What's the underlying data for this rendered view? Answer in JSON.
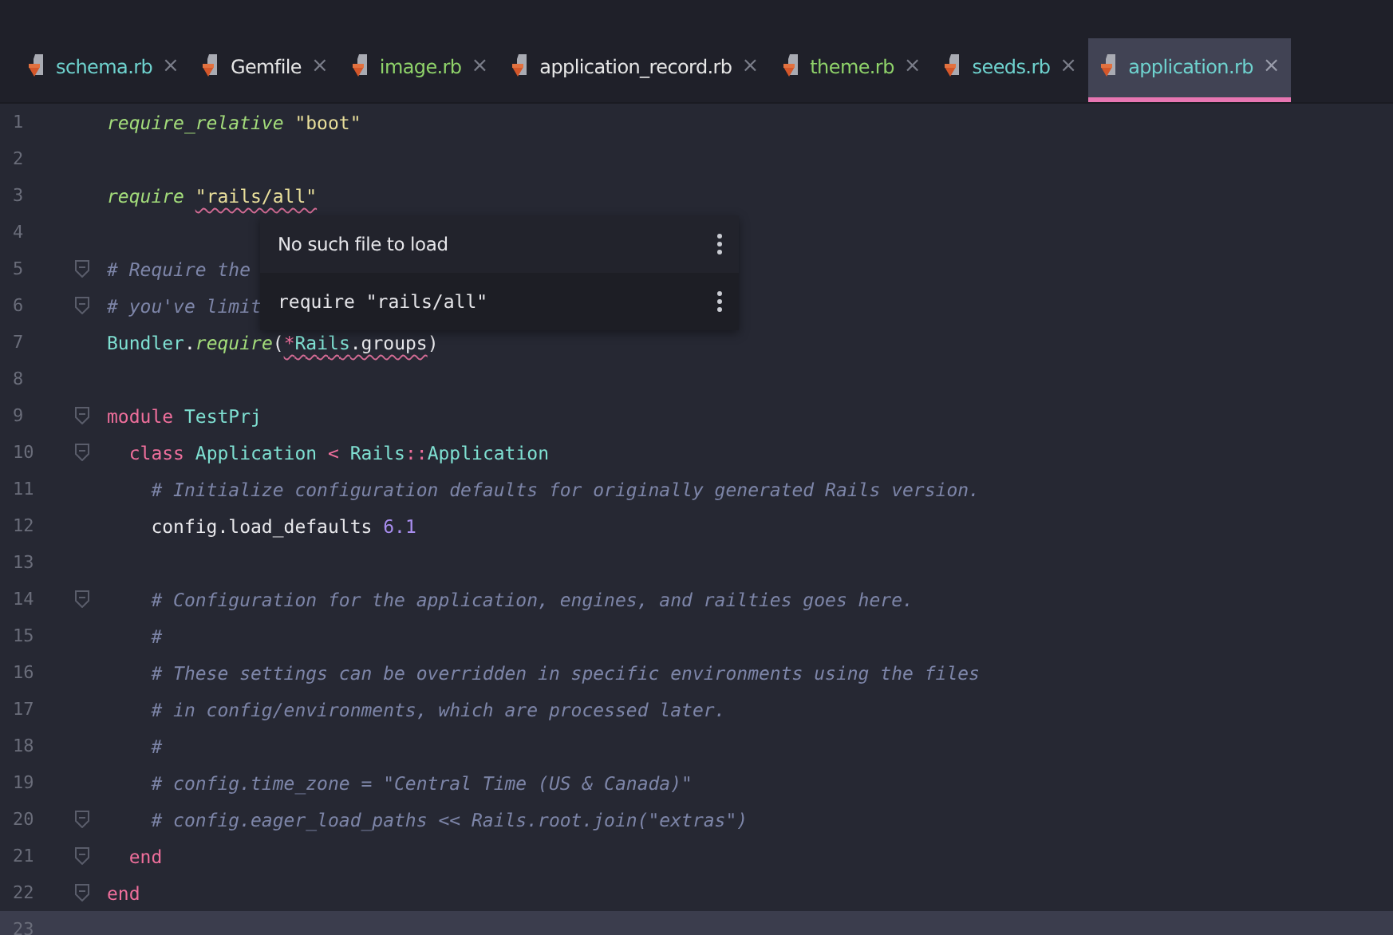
{
  "tabs": [
    {
      "label": "schema.rb",
      "color": "#6fd3cf",
      "selected": false,
      "close": "×"
    },
    {
      "label": "Gemfile",
      "color": "#e6e6e6",
      "selected": false,
      "close": "×"
    },
    {
      "label": "image.rb",
      "color": "#8fd36a",
      "selected": false,
      "close": "×"
    },
    {
      "label": "application_record.rb",
      "color": "#e6e6e6",
      "selected": false,
      "close": "×"
    },
    {
      "label": "theme.rb",
      "color": "#8fd36a",
      "selected": false,
      "close": "×"
    },
    {
      "label": "seeds.rb",
      "color": "#6fd3cf",
      "selected": false,
      "close": "×"
    },
    {
      "label": "application.rb",
      "color": "#6fd3cf",
      "selected": true,
      "close": "×"
    }
  ],
  "lines": [
    {
      "number": "1",
      "fold": false,
      "tokens": [
        {
          "t": "require_relative",
          "kind": "method"
        },
        {
          "t": " \"boot\"",
          "kind": "string"
        }
      ]
    },
    {
      "number": "2",
      "fold": false
    },
    {
      "number": "3",
      "fold": false,
      "tokens": [
        {
          "t": "require ",
          "kind": "method"
        },
        {
          "t": "\"rails/all\"",
          "kind": "string",
          "error": true
        }
      ]
    },
    {
      "number": "4",
      "fold": false
    },
    {
      "number": "5",
      "fold": true,
      "tokens": [
        {
          "t": "# Require the",
          "kind": "comment"
        }
      ]
    },
    {
      "number": "6",
      "fold": true,
      "tokens": [
        {
          "t": "# you've limit",
          "kind": "comment"
        }
      ]
    },
    {
      "number": "7",
      "fold": false,
      "tokens": [
        {
          "t": "Bundler",
          "kind": "const"
        },
        {
          "t": ".",
          "kind": "plain"
        },
        {
          "t": "require",
          "kind": "method"
        },
        {
          "t": "(",
          "kind": "plain"
        },
        {
          "t": "*",
          "kind": "op",
          "error": true
        },
        {
          "t": "Rails",
          "kind": "const",
          "error": true
        },
        {
          "t": ".groups",
          "kind": "plain",
          "error": true
        },
        {
          "t": ")",
          "kind": "plain"
        }
      ]
    },
    {
      "number": "8",
      "fold": false
    },
    {
      "number": "9",
      "fold": true,
      "tokens": [
        {
          "t": "module",
          "kind": "keyword"
        },
        {
          "t": " TestPrj",
          "kind": "const"
        }
      ]
    },
    {
      "number": "10",
      "fold": true,
      "tokens": [
        {
          "t": "  class",
          "kind": "keyword"
        },
        {
          "t": " Application",
          "kind": "const"
        },
        {
          "t": " <",
          "kind": "op"
        },
        {
          "t": " Rails",
          "kind": "const"
        },
        {
          "t": "::",
          "kind": "op"
        },
        {
          "t": "Application",
          "kind": "const"
        }
      ]
    },
    {
      "number": "11",
      "fold": false,
      "tokens": [
        {
          "t": "    # Initialize configuration defaults for originally generated Rails version.",
          "kind": "comment"
        }
      ]
    },
    {
      "number": "12",
      "fold": false,
      "tokens": [
        {
          "t": "    config.load_defaults",
          "kind": "plain"
        },
        {
          "t": " 6.1",
          "kind": "number"
        }
      ]
    },
    {
      "number": "13",
      "fold": false
    },
    {
      "number": "14",
      "fold": true,
      "tokens": [
        {
          "t": "    # Configuration for the application, engines, and railties goes here.",
          "kind": "comment"
        }
      ]
    },
    {
      "number": "15",
      "fold": false,
      "tokens": [
        {
          "t": "    #",
          "kind": "comment"
        }
      ]
    },
    {
      "number": "16",
      "fold": false,
      "tokens": [
        {
          "t": "    # These settings can be overridden in specific environments using the files",
          "kind": "comment"
        }
      ]
    },
    {
      "number": "17",
      "fold": false,
      "tokens": [
        {
          "t": "    # in config/environments, which are processed later.",
          "kind": "comment"
        }
      ]
    },
    {
      "number": "18",
      "fold": false,
      "tokens": [
        {
          "t": "    #",
          "kind": "comment"
        }
      ]
    },
    {
      "number": "19",
      "fold": false,
      "tokens": [
        {
          "t": "    # config.time_zone = \"Central Time (US & Canada)\"",
          "kind": "comment"
        }
      ]
    },
    {
      "number": "20",
      "fold": true,
      "tokens": [
        {
          "t": "    # config.eager_load_paths << Rails.root.join(\"extras\")",
          "kind": "comment"
        }
      ]
    },
    {
      "number": "21",
      "fold": true,
      "tokens": [
        {
          "t": "  end",
          "kind": "keyword"
        }
      ]
    },
    {
      "number": "22",
      "fold": true,
      "tokens": [
        {
          "t": "end",
          "kind": "keyword"
        }
      ]
    },
    {
      "number": "23",
      "fold": false,
      "current": true
    }
  ],
  "popup": {
    "message": "No such file to load",
    "code": "require \"rails/all\""
  }
}
